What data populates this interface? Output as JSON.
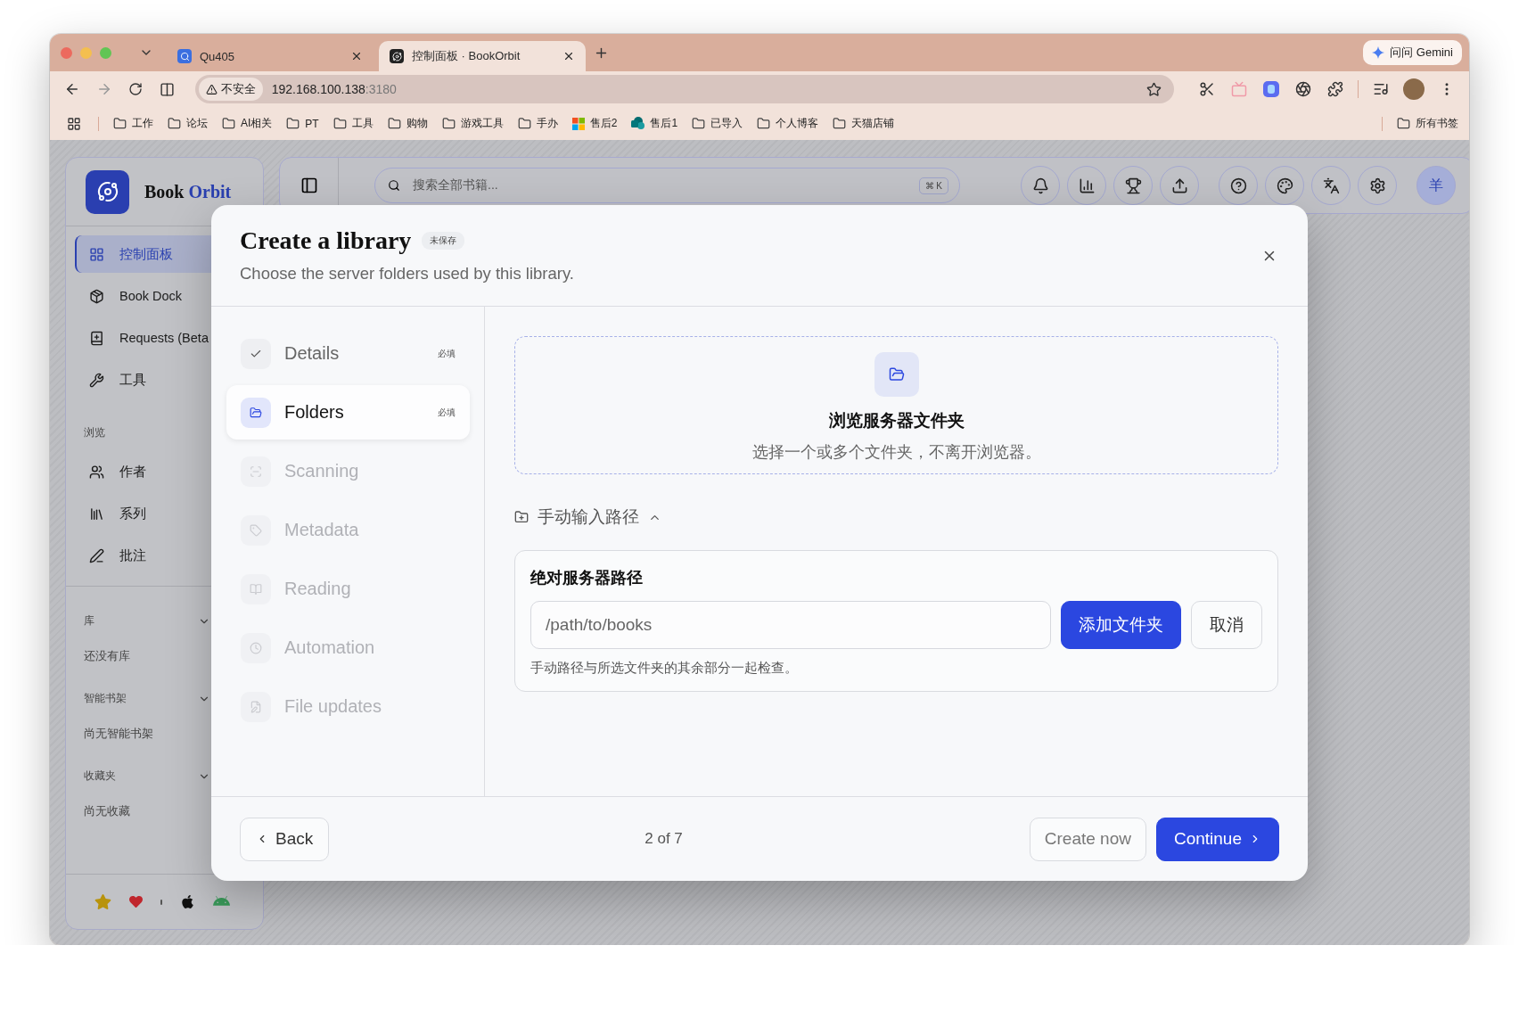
{
  "browser": {
    "tabs": [
      {
        "title": "Qu405",
        "selected": false
      },
      {
        "title": "控制面板 · BookOrbit",
        "selected": true
      }
    ],
    "gemini": "问问 Gemini",
    "address": {
      "security": "不安全",
      "host": "192.168.100.138",
      "port": ":3180"
    },
    "bookmarks": [
      {
        "label": "工作",
        "kind": "folder"
      },
      {
        "label": "论坛",
        "kind": "folder"
      },
      {
        "label": "AI相关",
        "kind": "folder"
      },
      {
        "label": "PT",
        "kind": "folder"
      },
      {
        "label": "工具",
        "kind": "folder"
      },
      {
        "label": "购物",
        "kind": "folder"
      },
      {
        "label": "游戏工具",
        "kind": "folder"
      },
      {
        "label": "手办",
        "kind": "folder"
      },
      {
        "label": "售后2",
        "kind": "windows"
      },
      {
        "label": "售后1",
        "kind": "sharepoint"
      },
      {
        "label": "已导入",
        "kind": "folder"
      },
      {
        "label": "个人博客",
        "kind": "folder"
      },
      {
        "label": "天猫店铺",
        "kind": "folder"
      }
    ],
    "all_bookmarks": "所有书签"
  },
  "sidebar": {
    "brand": {
      "first": "Book",
      "second": "Orbit"
    },
    "nav": [
      {
        "label": "控制面板",
        "selected": true
      },
      {
        "label": "Book Dock",
        "selected": false
      },
      {
        "label": "Requests (Beta",
        "selected": false
      },
      {
        "label": "工具",
        "selected": false
      }
    ],
    "browse": {
      "title": "浏览",
      "items": [
        "作者",
        "系列",
        "批注"
      ]
    },
    "sections": [
      {
        "title": "库",
        "expanded": true,
        "empty": "还没有库"
      },
      {
        "title": "智能书架",
        "expanded": true,
        "empty": "尚无智能书架"
      },
      {
        "title": "收藏夹",
        "expanded": true,
        "empty": "尚无收藏"
      }
    ]
  },
  "header": {
    "search": {
      "placeholder": "搜索全部书籍...",
      "shortcut": "⌘ K"
    },
    "avatar": "羊"
  },
  "dialog": {
    "title": "Create a library",
    "badge": "未保存",
    "subtitle": "Choose the server folders used by this library.",
    "steps": [
      {
        "label": "Details",
        "selected": false,
        "disabled": false,
        "required": "必填"
      },
      {
        "label": "Folders",
        "selected": true,
        "disabled": false,
        "required": "必填"
      },
      {
        "label": "Scanning",
        "selected": false,
        "disabled": true
      },
      {
        "label": "Metadata",
        "selected": false,
        "disabled": true
      },
      {
        "label": "Reading",
        "selected": false,
        "disabled": true
      },
      {
        "label": "Automation",
        "selected": false,
        "disabled": true
      },
      {
        "label": "File updates",
        "selected": false,
        "disabled": true
      }
    ],
    "browse": {
      "title": "浏览服务器文件夹",
      "text": "选择一个或多个文件夹，不离开浏览器。"
    },
    "manual": {
      "label": "手动输入路径",
      "expanded": true,
      "field_label": "绝对服务器路径",
      "placeholder": "/path/to/books",
      "add": "添加文件夹",
      "cancel": "取消",
      "hint": "手动路径与所选文件夹的其余部分一起检查。"
    },
    "footer": {
      "back": "Back",
      "progress": "2 of 7",
      "create": "Create now",
      "continue": "Continue"
    }
  }
}
